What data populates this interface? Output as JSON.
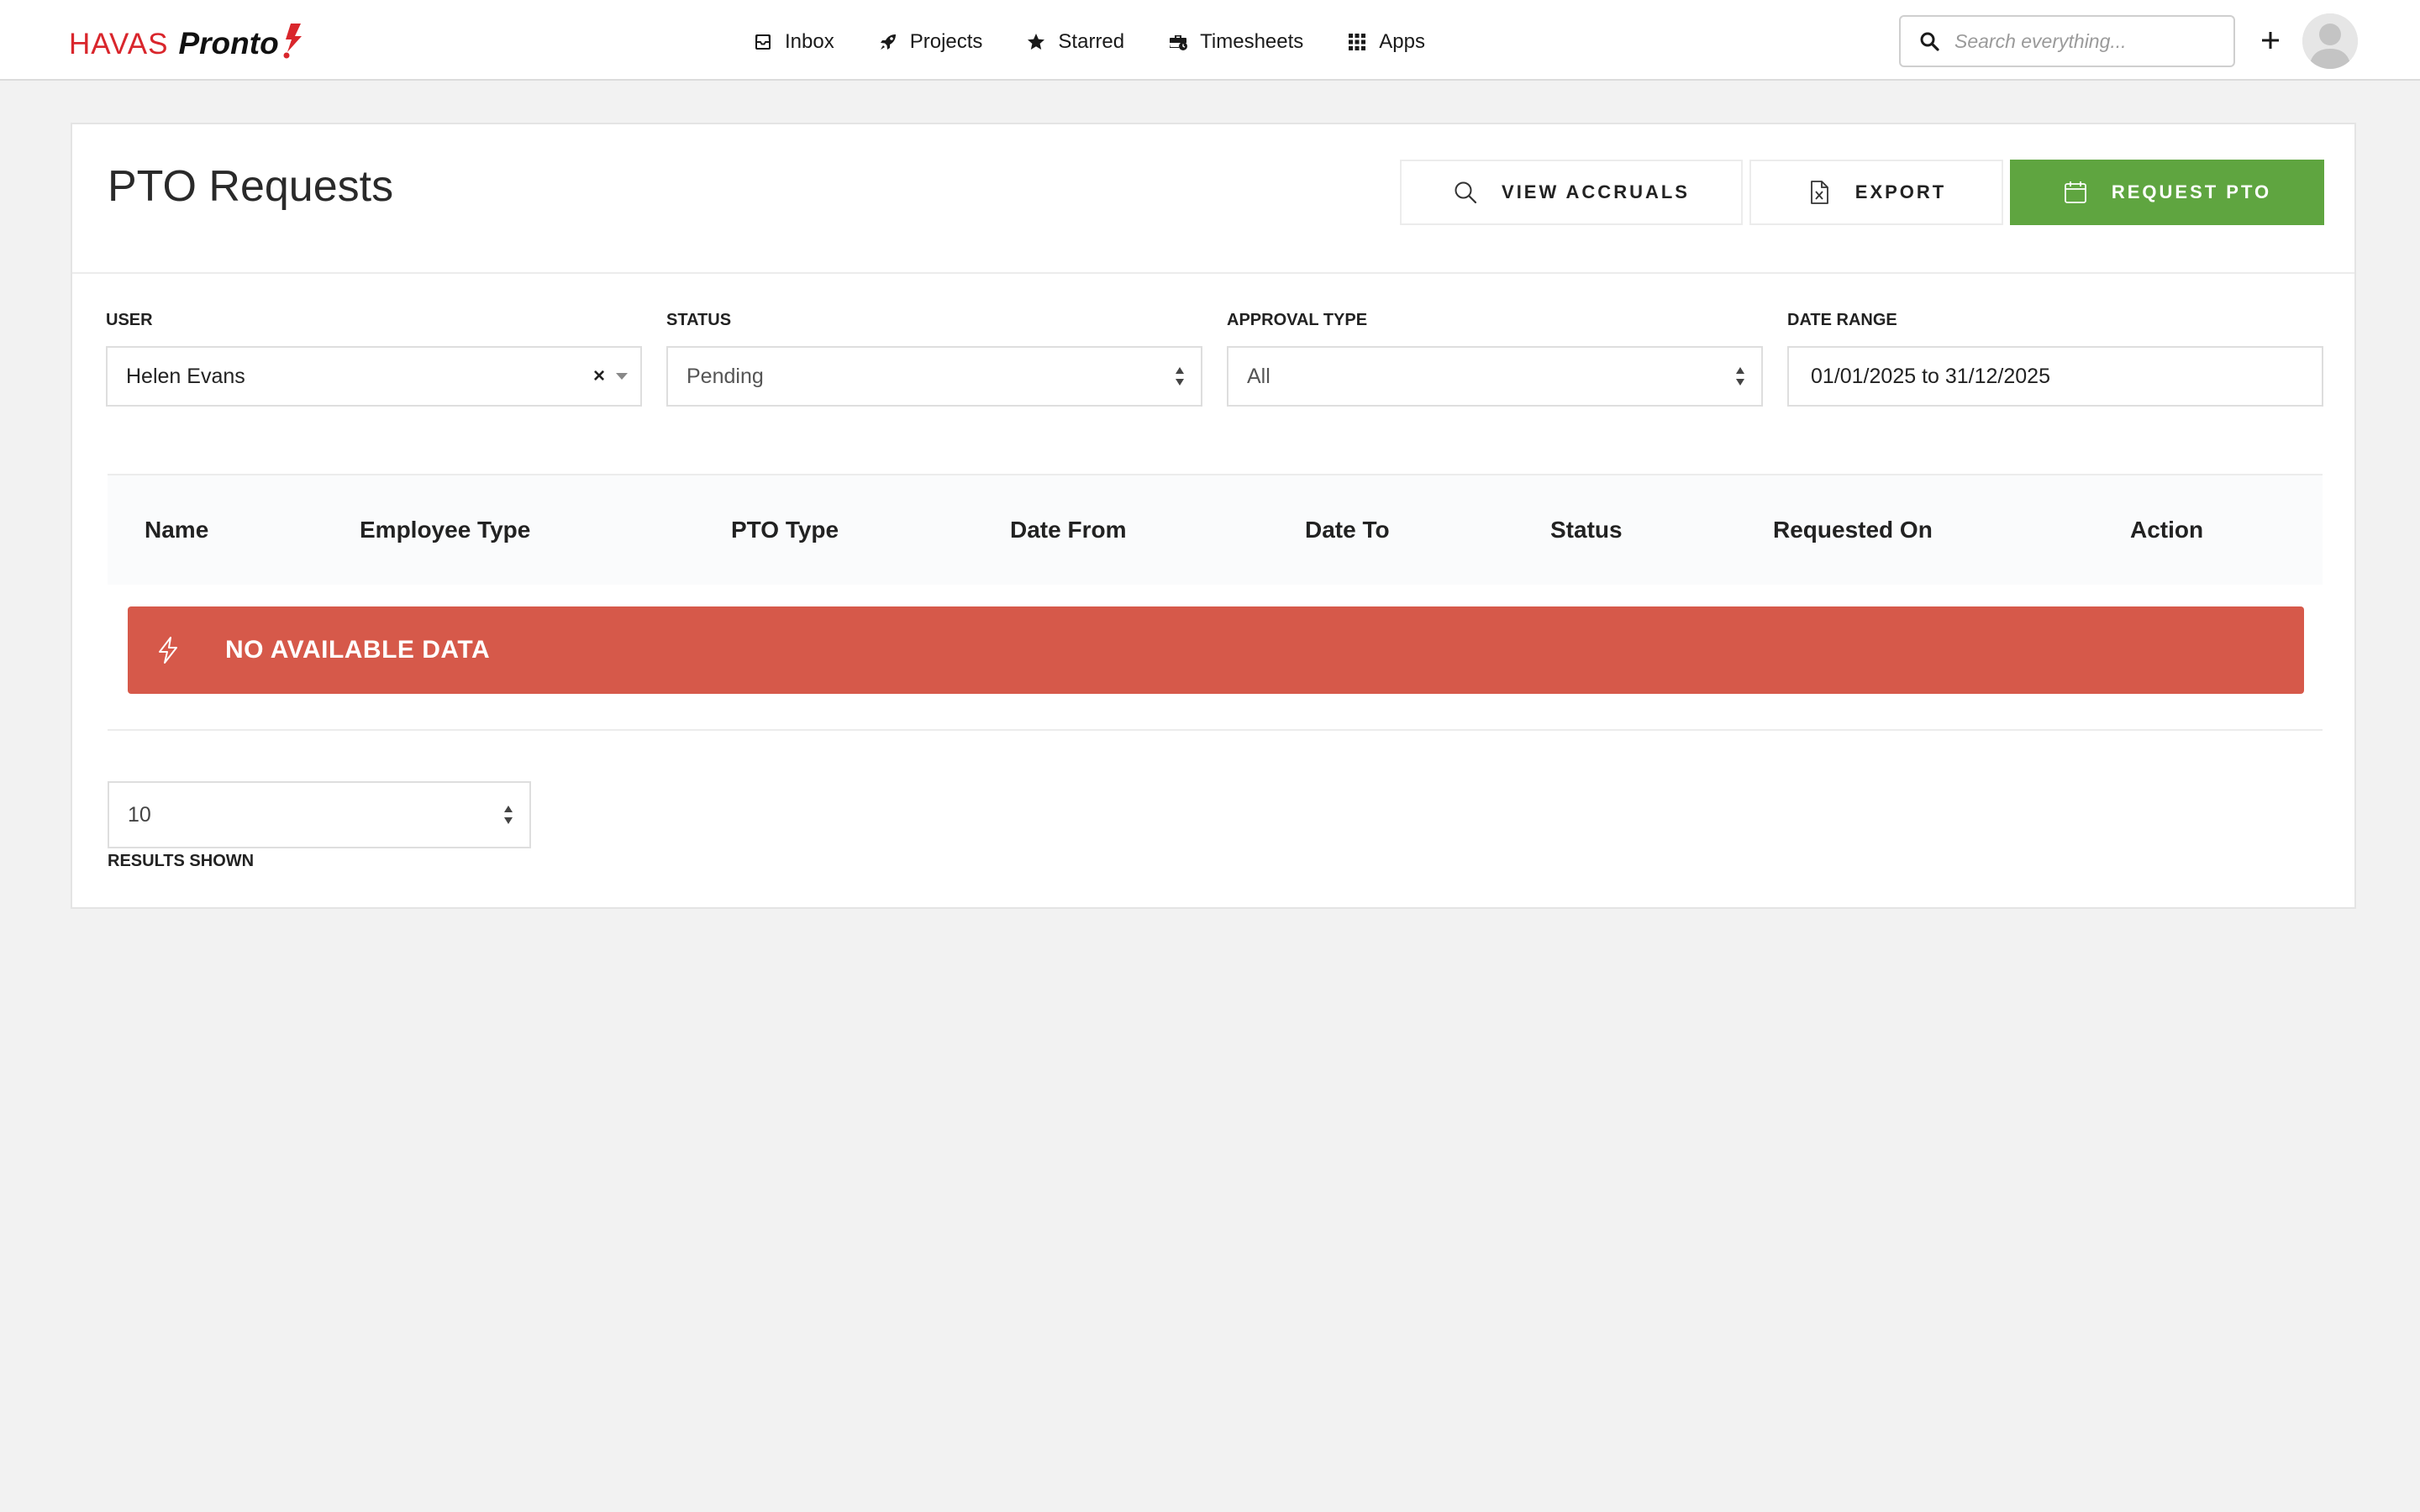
{
  "brand": {
    "primary": "HAVAS",
    "secondary": "Pronto",
    "brand_color": "#d9262c"
  },
  "nav": [
    {
      "label": "Inbox",
      "icon": "inbox-icon"
    },
    {
      "label": "Projects",
      "icon": "rocket-icon"
    },
    {
      "label": "Starred",
      "icon": "star-icon"
    },
    {
      "label": "Timesheets",
      "icon": "timesheets-icon"
    },
    {
      "label": "Apps",
      "icon": "apps-grid-icon"
    }
  ],
  "search": {
    "placeholder": "Search everything..."
  },
  "page": {
    "title": "PTO Requests"
  },
  "actions": {
    "view_accruals": "VIEW ACCRUALS",
    "export": "EXPORT",
    "request_pto": "REQUEST PTO",
    "accent_color": "#5fa540"
  },
  "filters": {
    "user": {
      "label": "USER",
      "value": "Helen Evans"
    },
    "status": {
      "label": "STATUS",
      "value": "Pending"
    },
    "approval_type": {
      "label": "APPROVAL TYPE",
      "value": "All"
    },
    "date_range": {
      "label": "DATE RANGE",
      "value": "01/01/2025 to 31/12/2025"
    }
  },
  "table": {
    "columns": [
      "Name",
      "Employee Type",
      "PTO Type",
      "Date From",
      "Date To",
      "Status",
      "Requested On",
      "Action"
    ],
    "rows": [],
    "empty_message": "NO AVAILABLE DATA",
    "empty_color": "#d6594a"
  },
  "pagination": {
    "page_size": "10",
    "results_label": "RESULTS SHOWN"
  }
}
